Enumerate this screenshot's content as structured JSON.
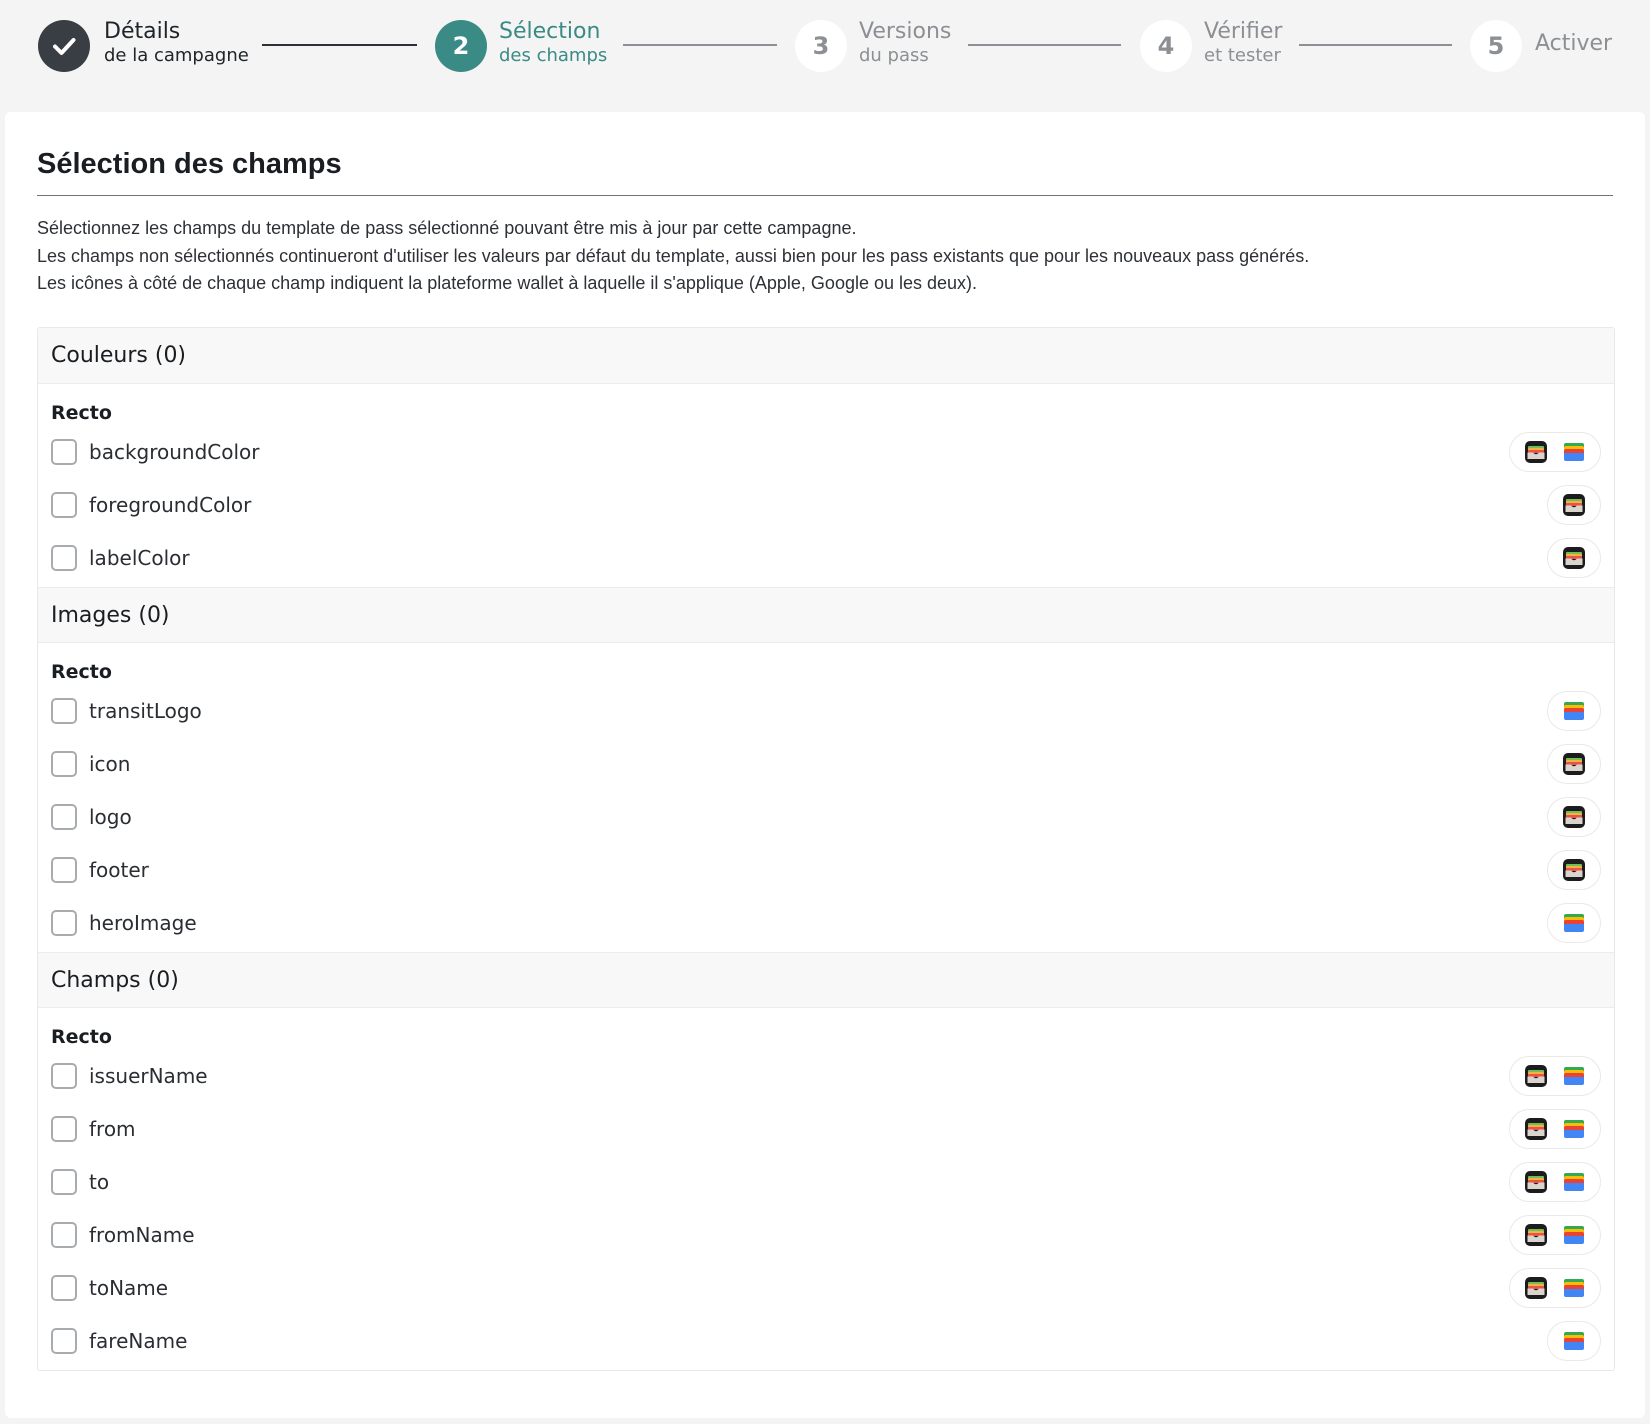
{
  "stepper": {
    "steps": [
      {
        "number": "",
        "title": "Détails",
        "subtitle": "de la campagne",
        "state": "done",
        "icon": "check-icon"
      },
      {
        "number": "2",
        "title": "Sélection",
        "subtitle": "des champs",
        "state": "active"
      },
      {
        "number": "3",
        "title": "Versions",
        "subtitle": "du pass",
        "state": "todo"
      },
      {
        "number": "4",
        "title": "Vérifier",
        "subtitle": "et tester",
        "state": "todo"
      },
      {
        "number": "5",
        "title": "Activer",
        "subtitle": "",
        "state": "todo"
      }
    ]
  },
  "page": {
    "title": "Sélection des champs",
    "description": [
      "Sélectionnez les champs du template de pass sélectionné pouvant être mis à jour par cette campagne.",
      "Les champs non sélectionnés continueront d'utiliser les valeurs par défaut du template, aussi bien pour les pass existants que pour les nouveaux pass générés.",
      "Les icônes à côté de chaque champ indiquent la plateforme wallet à laquelle il s'applique (Apple, Google ou les deux)."
    ]
  },
  "sections": [
    {
      "title": "Couleurs (0)",
      "group": "Recto",
      "fields": [
        {
          "name": "backgroundColor",
          "checked": false,
          "platforms": [
            "apple-wallet-icon",
            "google-wallet-icon"
          ]
        },
        {
          "name": "foregroundColor",
          "checked": false,
          "platforms": [
            "apple-wallet-icon"
          ]
        },
        {
          "name": "labelColor",
          "checked": false,
          "platforms": [
            "apple-wallet-icon"
          ]
        }
      ]
    },
    {
      "title": "Images (0)",
      "group": "Recto",
      "fields": [
        {
          "name": "transitLogo",
          "checked": false,
          "platforms": [
            "google-wallet-icon"
          ]
        },
        {
          "name": "icon",
          "checked": false,
          "platforms": [
            "apple-wallet-icon"
          ]
        },
        {
          "name": "logo",
          "checked": false,
          "platforms": [
            "apple-wallet-icon"
          ]
        },
        {
          "name": "footer",
          "checked": false,
          "platforms": [
            "apple-wallet-icon"
          ]
        },
        {
          "name": "heroImage",
          "checked": false,
          "platforms": [
            "google-wallet-icon"
          ]
        }
      ]
    },
    {
      "title": "Champs (0)",
      "group": "Recto",
      "fields": [
        {
          "name": "issuerName",
          "checked": false,
          "platforms": [
            "apple-wallet-icon",
            "google-wallet-icon"
          ]
        },
        {
          "name": "from",
          "checked": false,
          "platforms": [
            "apple-wallet-icon",
            "google-wallet-icon"
          ]
        },
        {
          "name": "to",
          "checked": false,
          "platforms": [
            "apple-wallet-icon",
            "google-wallet-icon"
          ]
        },
        {
          "name": "fromName",
          "checked": false,
          "platforms": [
            "apple-wallet-icon",
            "google-wallet-icon"
          ]
        },
        {
          "name": "toName",
          "checked": false,
          "platforms": [
            "apple-wallet-icon",
            "google-wallet-icon"
          ]
        },
        {
          "name": "fareName",
          "checked": false,
          "platforms": [
            "google-wallet-icon"
          ]
        }
      ]
    }
  ],
  "colors": {
    "accent": "#3a8a86",
    "done": "#393d44",
    "inactive": "#8c8f93"
  }
}
